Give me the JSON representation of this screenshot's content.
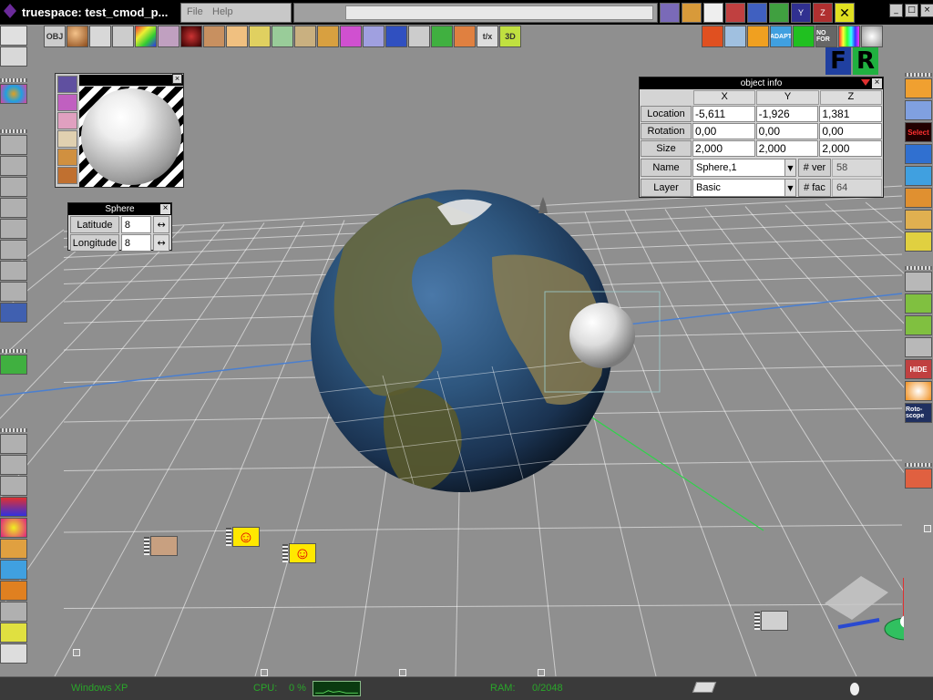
{
  "app": {
    "title": "truespace: test_cmod_p...",
    "menu": [
      "File",
      "Help"
    ]
  },
  "top_icons": [
    "scene-icon",
    "box-icon",
    "window-icon",
    "house-icon",
    "image-icon",
    "grid-icon",
    "y-icon",
    "z-icon",
    "cross-icon"
  ],
  "window_controls": {
    "minimize": "_",
    "restore": "□",
    "close": "×"
  },
  "toolbar": {
    "left": [
      "OBJ",
      "sphere",
      "lasso",
      "film",
      "rainbow",
      "tiles",
      "ball-red",
      "cylinder",
      "dots",
      "paint",
      "curve",
      "clay",
      "palette",
      "swirl",
      "flag",
      "disc",
      "axes",
      "cube",
      "x-tool",
      "t/x",
      "3D"
    ],
    "right": [
      "cube-color",
      "ribbons",
      "house",
      "ADAPT",
      "eye",
      "NO FOR",
      "color-picker",
      "ball"
    ]
  },
  "fr": {
    "f_label": "F",
    "r_label": "R"
  },
  "material_panel": {
    "sidebar_count": 6
  },
  "sphere_panel": {
    "title": "Sphere",
    "close": "×",
    "fields": [
      {
        "label": "Latitude",
        "value": "8"
      },
      {
        "label": "Longitude",
        "value": "8"
      }
    ],
    "arrow": "↔"
  },
  "object_info": {
    "title": "object info",
    "close": "×",
    "columns": [
      "X",
      "Y",
      "Z"
    ],
    "rows": [
      {
        "label": "Location",
        "x": "-5,611",
        "y": "-1,926",
        "z": "1,381"
      },
      {
        "label": "Rotation",
        "x": "0,00",
        "y": "0,00",
        "z": "0,00"
      },
      {
        "label": "Size",
        "x": "2,000",
        "y": "2,000",
        "z": "2,000"
      }
    ],
    "name_label": "Name",
    "name_value": "Sphere,1",
    "layer_label": "Layer",
    "layer_value": "Basic",
    "ver_label": "# ver",
    "ver_value": "58",
    "fac_label": "# fac",
    "fac_value": "64"
  },
  "right_toolbar": [
    "arrow",
    "arrows",
    "Select",
    "cube-blue",
    "bend",
    "box",
    "box2",
    "cd",
    "nav1",
    "nav2",
    "nav3",
    "lock",
    "HIDE",
    "orange",
    "Roto-scope",
    "delete"
  ],
  "widgets": {
    "smile": "☺"
  },
  "status": {
    "os": "Windows XP",
    "cpu_label": "CPU:",
    "cpu_value": "0 %",
    "ram_label": "RAM:",
    "ram_value": "0/2048"
  },
  "colors": {
    "grid": "#ffffff",
    "x_axis": "#4a7fd0",
    "y_axis": "#2fd34a",
    "status_text": "#2aa62a",
    "select_red": "#ff3030"
  }
}
